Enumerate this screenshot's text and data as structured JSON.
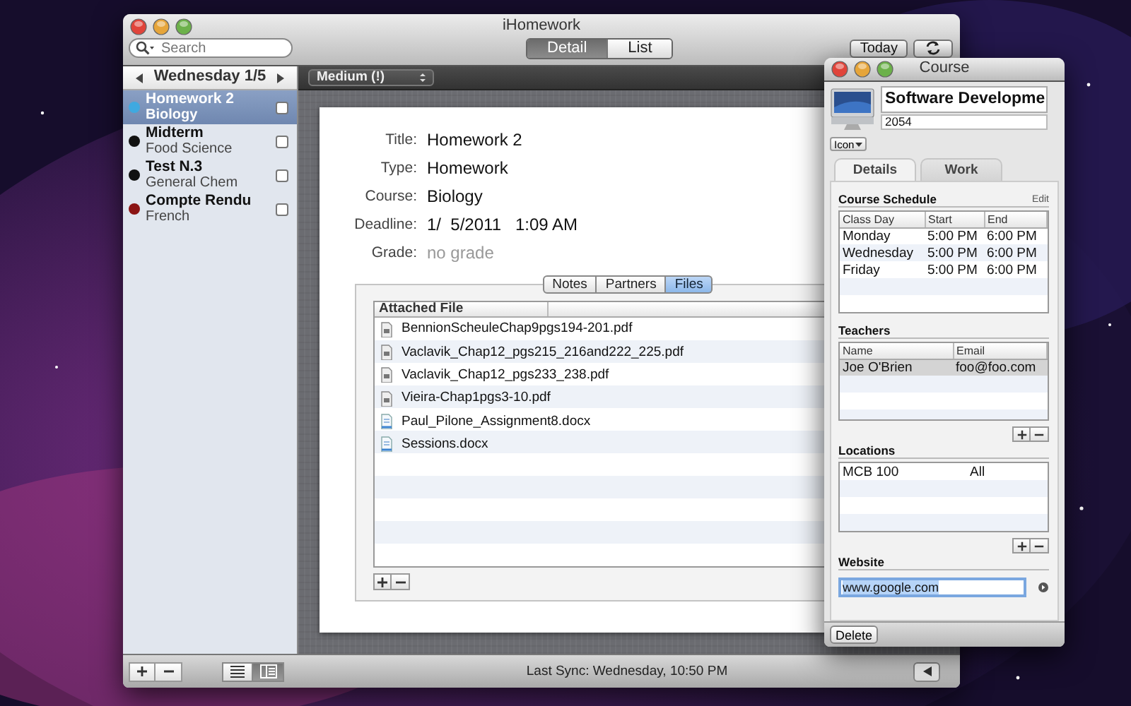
{
  "main_window": {
    "title": "iHomework",
    "search": {
      "placeholder": "Search"
    },
    "view_tabs": [
      {
        "label": "Detail",
        "selected": true
      },
      {
        "label": "List",
        "selected": false
      }
    ],
    "today_button": "Today",
    "sidebar": {
      "date": "Wednesday 1/5",
      "items": [
        {
          "title": "Homework 2",
          "course": "Biology",
          "color": "#3fa9e0",
          "checked": false,
          "selected": true
        },
        {
          "title": "Midterm",
          "course": "Food Science",
          "color": "#111111",
          "checked": false,
          "selected": false
        },
        {
          "title": "Test N.3",
          "course": "General Chem",
          "color": "#111111",
          "checked": false,
          "selected": false
        },
        {
          "title": "Compte Rendu",
          "course": "French",
          "color": "#8b1414",
          "checked": false,
          "selected": false
        }
      ]
    },
    "priority": "Medium (!)",
    "fields": [
      {
        "label": "Title:",
        "value": "Homework 2",
        "kind": "value"
      },
      {
        "label": "Type:",
        "value": "Homework",
        "kind": "value"
      },
      {
        "label": "Course:",
        "value": "Biology",
        "kind": "value"
      },
      {
        "label": "Deadline:",
        "value": "1/  5/2011   1:09 AM",
        "kind": "value"
      },
      {
        "label": "Grade:",
        "value": "no grade",
        "kind": "hint"
      }
    ],
    "detail_tabs": [
      {
        "label": "Notes",
        "selected": false
      },
      {
        "label": "Partners",
        "selected": false
      },
      {
        "label": "Files",
        "selected": true
      }
    ],
    "files": {
      "column": "Attached File",
      "rows": [
        {
          "name": "BennionScheuleChap9pgs194-201.pdf",
          "kind": "pdf"
        },
        {
          "name": "Vaclavik_Chap12_pgs215_216and222_225.pdf",
          "kind": "pdf"
        },
        {
          "name": "Vaclavik_Chap12_pgs233_238.pdf",
          "kind": "pdf"
        },
        {
          "name": "Vieira-Chap1pgs3-10.pdf",
          "kind": "pdf"
        },
        {
          "name": "Paul_Pilone_Assignment8.docx",
          "kind": "docx"
        },
        {
          "name": "Sessions.docx",
          "kind": "docx"
        }
      ]
    },
    "view_modes": [
      {
        "kind": "list",
        "selected": false
      },
      {
        "kind": "columns",
        "selected": true
      }
    ],
    "status": "Last Sync: Wednesday, 10:50 PM"
  },
  "course_window": {
    "title": "Course",
    "name": "Software Developme",
    "number": "2054",
    "icon_menu": "Icon",
    "tabs": [
      {
        "label": "Details",
        "selected": true
      },
      {
        "label": "Work",
        "selected": false
      }
    ],
    "schedule": {
      "title": "Course Schedule",
      "edit": "Edit",
      "columns": [
        "Class Day",
        "Start",
        "End"
      ],
      "rows": [
        [
          "Monday",
          "5:00 PM",
          "6:00 PM"
        ],
        [
          "Wednesday",
          "5:00 PM",
          "6:00 PM"
        ],
        [
          "Friday",
          "5:00 PM",
          "6:00 PM"
        ]
      ]
    },
    "teachers": {
      "title": "Teachers",
      "columns": [
        "Name",
        "Email"
      ],
      "rows": [
        {
          "cells": [
            "Joe O'Brien",
            "foo@foo.com"
          ],
          "selected": true
        }
      ]
    },
    "locations": {
      "title": "Locations",
      "rows": [
        [
          "MCB 100",
          "All"
        ]
      ]
    },
    "website": {
      "title": "Website",
      "value": "www.google.com"
    },
    "delete_button": "Delete"
  }
}
